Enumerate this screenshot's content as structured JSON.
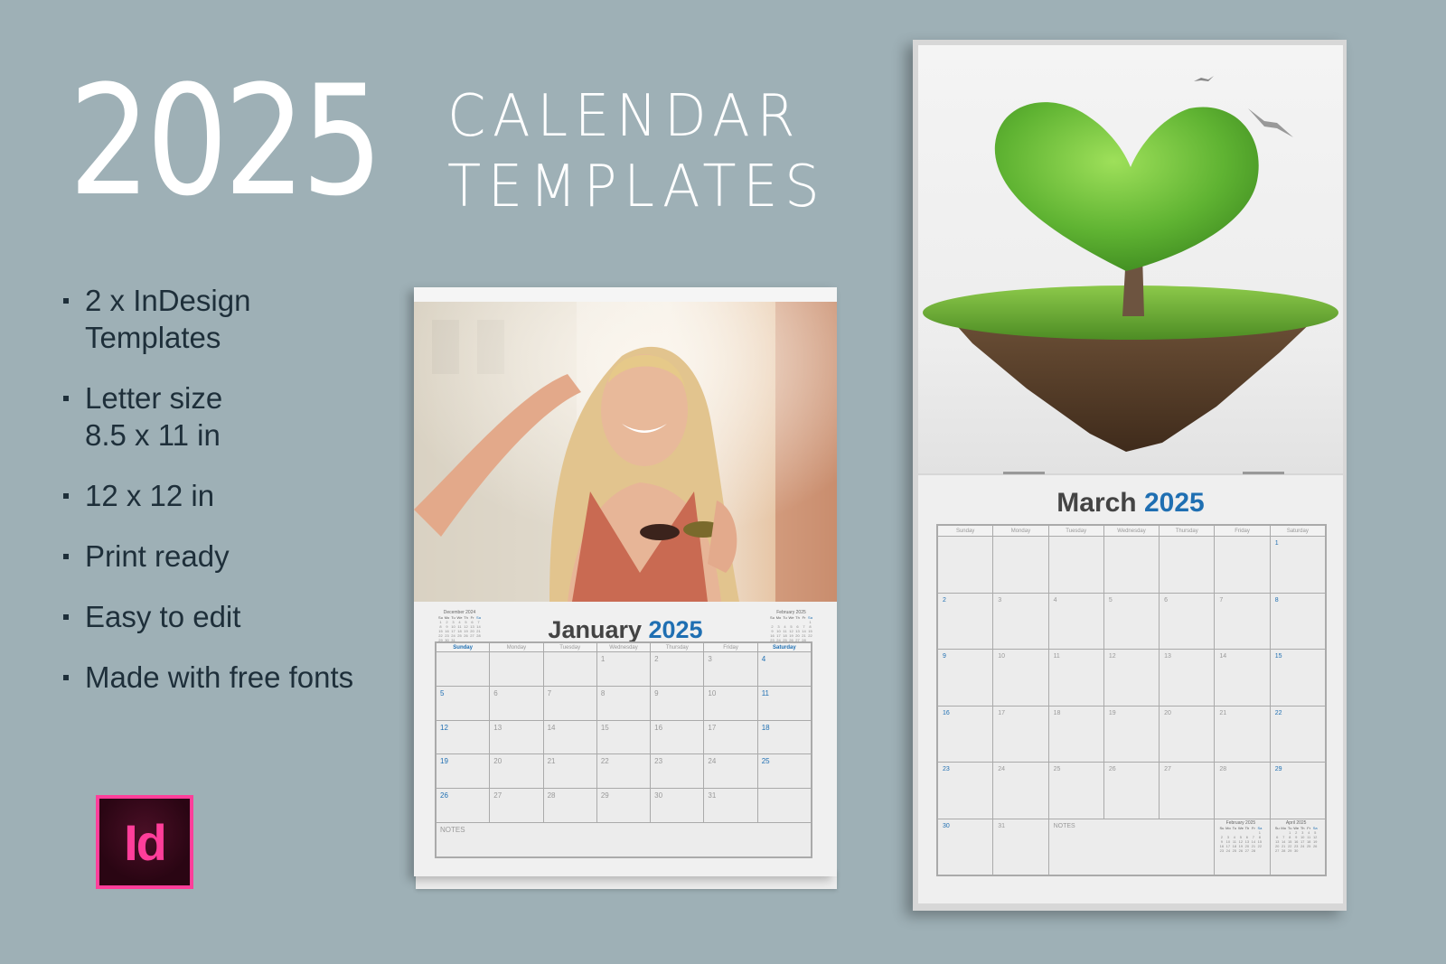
{
  "hero": {
    "year": "2025",
    "line1": "CALENDAR",
    "line2": "TEMPLATES"
  },
  "features": [
    {
      "lines": [
        "2 x InDesign",
        "Templates"
      ]
    },
    {
      "lines": [
        "Letter size",
        "8.5 x 11 in"
      ]
    },
    {
      "lines": [
        "12 x 12 in"
      ]
    },
    {
      "lines": [
        "Print ready"
      ]
    },
    {
      "lines": [
        "Easy to edit"
      ]
    },
    {
      "lines": [
        "Made with free fonts"
      ]
    }
  ],
  "logo": {
    "text": "Id",
    "icon": "adobe-indesign-icon",
    "border_color": "#ff3e9a"
  },
  "colors": {
    "accent": "#1f6fb2",
    "month_text": "#444444",
    "background": "#9eb0b6"
  },
  "weekdays": [
    "Sunday",
    "Monday",
    "Tuesday",
    "Wednesday",
    "Thursday",
    "Friday",
    "Saturday"
  ],
  "mini_weekdays": [
    "Su",
    "Mo",
    "Tu",
    "We",
    "Th",
    "Fr",
    "Sa"
  ],
  "notes_label": "NOTES",
  "january": {
    "month": "January",
    "year": "2025",
    "photo": "woman-with-sunglasses-photo",
    "weeks": [
      [
        "",
        "",
        "",
        "1",
        "2",
        "3",
        "4"
      ],
      [
        "5",
        "6",
        "7",
        "8",
        "9",
        "10",
        "11"
      ],
      [
        "12",
        "13",
        "14",
        "15",
        "16",
        "17",
        "18"
      ],
      [
        "19",
        "20",
        "21",
        "22",
        "23",
        "24",
        "25"
      ],
      [
        "26",
        "27",
        "28",
        "29",
        "30",
        "31",
        ""
      ]
    ],
    "mini_prev": {
      "title": "December 2024",
      "weeks": [
        [
          "1",
          "2",
          "3",
          "4",
          "5",
          "6",
          "7"
        ],
        [
          "8",
          "9",
          "10",
          "11",
          "12",
          "13",
          "14"
        ],
        [
          "15",
          "16",
          "17",
          "18",
          "19",
          "20",
          "21"
        ],
        [
          "22",
          "23",
          "24",
          "25",
          "26",
          "27",
          "28"
        ],
        [
          "29",
          "30",
          "31",
          "",
          "",
          "",
          ""
        ]
      ]
    },
    "mini_next": {
      "title": "February 2025",
      "weeks": [
        [
          "",
          "",
          "",
          "",
          "",
          "",
          "1"
        ],
        [
          "2",
          "3",
          "4",
          "5",
          "6",
          "7",
          "8"
        ],
        [
          "9",
          "10",
          "11",
          "12",
          "13",
          "14",
          "15"
        ],
        [
          "16",
          "17",
          "18",
          "19",
          "20",
          "21",
          "22"
        ],
        [
          "23",
          "24",
          "25",
          "26",
          "27",
          "28",
          ""
        ]
      ]
    }
  },
  "march": {
    "month": "March",
    "year": "2025",
    "photo": "heart-tree-floating-island-photo",
    "weeks": [
      [
        "",
        "",
        "",
        "",
        "",
        "",
        "1"
      ],
      [
        "2",
        "3",
        "4",
        "5",
        "6",
        "7",
        "8"
      ],
      [
        "9",
        "10",
        "11",
        "12",
        "13",
        "14",
        "15"
      ],
      [
        "16",
        "17",
        "18",
        "19",
        "20",
        "21",
        "22"
      ],
      [
        "23",
        "24",
        "25",
        "26",
        "27",
        "28",
        "29"
      ]
    ],
    "last_row": [
      "30",
      "31"
    ],
    "mini_prev": {
      "title": "February 2025",
      "weeks": [
        [
          "",
          "",
          "",
          "",
          "",
          "",
          "1"
        ],
        [
          "2",
          "3",
          "4",
          "5",
          "6",
          "7",
          "8"
        ],
        [
          "9",
          "10",
          "11",
          "12",
          "13",
          "14",
          "15"
        ],
        [
          "16",
          "17",
          "18",
          "19",
          "20",
          "21",
          "22"
        ],
        [
          "23",
          "24",
          "25",
          "26",
          "27",
          "28",
          ""
        ]
      ]
    },
    "mini_next": {
      "title": "April 2025",
      "weeks": [
        [
          "",
          "",
          "1",
          "2",
          "3",
          "4",
          "5"
        ],
        [
          "6",
          "7",
          "8",
          "9",
          "10",
          "11",
          "12"
        ],
        [
          "13",
          "14",
          "15",
          "16",
          "17",
          "18",
          "19"
        ],
        [
          "20",
          "21",
          "22",
          "23",
          "24",
          "25",
          "26"
        ],
        [
          "27",
          "28",
          "29",
          "30",
          "",
          "",
          ""
        ]
      ]
    }
  }
}
